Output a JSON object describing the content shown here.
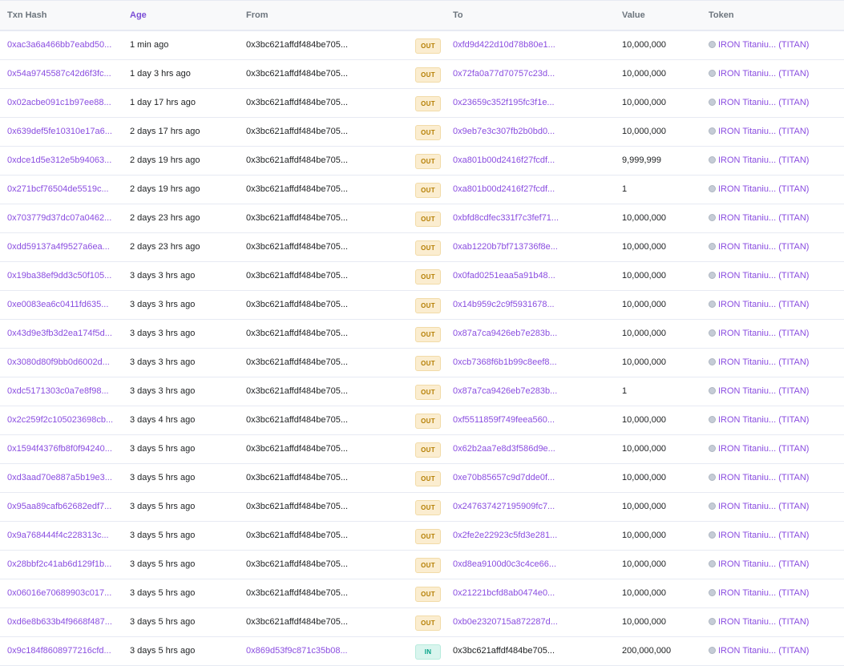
{
  "header": {
    "txn_hash": "Txn Hash",
    "age": "Age",
    "from": "From",
    "to": "To",
    "value": "Value",
    "token": "Token"
  },
  "token_label": "IRON Titaniu... (TITAN)",
  "icons": {
    "token": "token-coin-icon"
  },
  "colors": {
    "link": "#8a4de0",
    "out_badge": "#fbedd0",
    "in_badge": "#d9f5ee"
  },
  "rows": [
    {
      "hash": "0xac3a6a466bb7eabd50...",
      "age": "1 min ago",
      "from": "0x3bc621affdf484be705...",
      "dir": "OUT",
      "to": "0xfd9d422d10d78b80e1...",
      "value": "10,000,000"
    },
    {
      "hash": "0x54a9745587c42d6f3fc...",
      "age": "1 day 3 hrs ago",
      "from": "0x3bc621affdf484be705...",
      "dir": "OUT",
      "to": "0x72fa0a77d70757c23d...",
      "value": "10,000,000"
    },
    {
      "hash": "0x02acbe091c1b97ee88...",
      "age": "1 day 17 hrs ago",
      "from": "0x3bc621affdf484be705...",
      "dir": "OUT",
      "to": "0x23659c352f195fc3f1e...",
      "value": "10,000,000"
    },
    {
      "hash": "0x639def5fe10310e17a6...",
      "age": "2 days 17 hrs ago",
      "from": "0x3bc621affdf484be705...",
      "dir": "OUT",
      "to": "0x9eb7e3c307fb2b0bd0...",
      "value": "10,000,000"
    },
    {
      "hash": "0xdce1d5e312e5b94063...",
      "age": "2 days 19 hrs ago",
      "from": "0x3bc621affdf484be705...",
      "dir": "OUT",
      "to": "0xa801b00d2416f27fcdf...",
      "value": "9,999,999"
    },
    {
      "hash": "0x271bcf76504de5519c...",
      "age": "2 days 19 hrs ago",
      "from": "0x3bc621affdf484be705...",
      "dir": "OUT",
      "to": "0xa801b00d2416f27fcdf...",
      "value": "1"
    },
    {
      "hash": "0x703779d37dc07a0462...",
      "age": "2 days 23 hrs ago",
      "from": "0x3bc621affdf484be705...",
      "dir": "OUT",
      "to": "0xbfd8cdfec331f7c3fef71...",
      "value": "10,000,000"
    },
    {
      "hash": "0xdd59137a4f9527a6ea...",
      "age": "2 days 23 hrs ago",
      "from": "0x3bc621affdf484be705...",
      "dir": "OUT",
      "to": "0xab1220b7bf713736f8e...",
      "value": "10,000,000"
    },
    {
      "hash": "0x19ba38ef9dd3c50f105...",
      "age": "3 days 3 hrs ago",
      "from": "0x3bc621affdf484be705...",
      "dir": "OUT",
      "to": "0x0fad0251eaa5a91b48...",
      "value": "10,000,000"
    },
    {
      "hash": "0xe0083ea6c0411fd635...",
      "age": "3 days 3 hrs ago",
      "from": "0x3bc621affdf484be705...",
      "dir": "OUT",
      "to": "0x14b959c2c9f5931678...",
      "value": "10,000,000"
    },
    {
      "hash": "0x43d9e3fb3d2ea174f5d...",
      "age": "3 days 3 hrs ago",
      "from": "0x3bc621affdf484be705...",
      "dir": "OUT",
      "to": "0x87a7ca9426eb7e283b...",
      "value": "10,000,000"
    },
    {
      "hash": "0x3080d80f9bb0d6002d...",
      "age": "3 days 3 hrs ago",
      "from": "0x3bc621affdf484be705...",
      "dir": "OUT",
      "to": "0xcb7368f6b1b99c8eef8...",
      "value": "10,000,000"
    },
    {
      "hash": "0xdc5171303c0a7e8f98...",
      "age": "3 days 3 hrs ago",
      "from": "0x3bc621affdf484be705...",
      "dir": "OUT",
      "to": "0x87a7ca9426eb7e283b...",
      "value": "1"
    },
    {
      "hash": "0x2c259f2c105023698cb...",
      "age": "3 days 4 hrs ago",
      "from": "0x3bc621affdf484be705...",
      "dir": "OUT",
      "to": "0xf5511859f749feea560...",
      "value": "10,000,000"
    },
    {
      "hash": "0x1594f4376fb8f0f94240...",
      "age": "3 days 5 hrs ago",
      "from": "0x3bc621affdf484be705...",
      "dir": "OUT",
      "to": "0x62b2aa7e8d3f586d9e...",
      "value": "10,000,000"
    },
    {
      "hash": "0xd3aad70e887a5b19e3...",
      "age": "3 days 5 hrs ago",
      "from": "0x3bc621affdf484be705...",
      "dir": "OUT",
      "to": "0xe70b85657c9d7dde0f...",
      "value": "10,000,000"
    },
    {
      "hash": "0x95aa89cafb62682edf7...",
      "age": "3 days 5 hrs ago",
      "from": "0x3bc621affdf484be705...",
      "dir": "OUT",
      "to": "0x247637427195909fc7...",
      "value": "10,000,000"
    },
    {
      "hash": "0x9a768444f4c228313c...",
      "age": "3 days 5 hrs ago",
      "from": "0x3bc621affdf484be705...",
      "dir": "OUT",
      "to": "0x2fe2e22923c5fd3e281...",
      "value": "10,000,000"
    },
    {
      "hash": "0x28bbf2c41ab6d129f1b...",
      "age": "3 days 5 hrs ago",
      "from": "0x3bc621affdf484be705...",
      "dir": "OUT",
      "to": "0xd8ea9100d0c3c4ce66...",
      "value": "10,000,000"
    },
    {
      "hash": "0x06016e70689903c017...",
      "age": "3 days 5 hrs ago",
      "from": "0x3bc621affdf484be705...",
      "dir": "OUT",
      "to": "0x21221bcfd8ab0474e0...",
      "value": "10,000,000"
    },
    {
      "hash": "0xd6e8b633b4f9668f487...",
      "age": "3 days 5 hrs ago",
      "from": "0x3bc621affdf484be705...",
      "dir": "OUT",
      "to": "0xb0e2320715a872287d...",
      "value": "10,000,000"
    },
    {
      "hash": "0x9c184f8608977216cfd...",
      "age": "3 days 5 hrs ago",
      "from": "0x869d53f9c871c35b08...",
      "dir": "IN",
      "to": "0x3bc621affdf484be705...",
      "value": "200,000,000"
    }
  ]
}
